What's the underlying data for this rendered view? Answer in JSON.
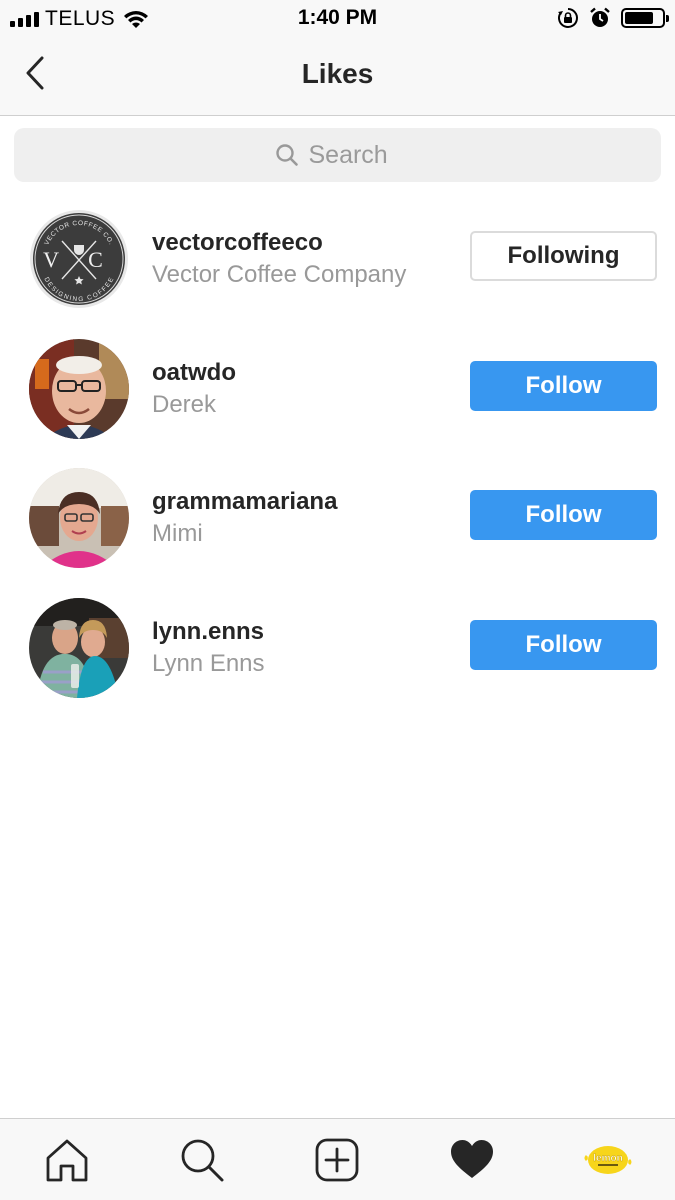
{
  "status_bar": {
    "carrier": "TELUS",
    "time": "1:40 PM"
  },
  "header": {
    "title": "Likes"
  },
  "search": {
    "placeholder": "Search"
  },
  "likes": [
    {
      "username": "vectorcoffeeco",
      "full_name": "Vector Coffee Company",
      "button": "Following",
      "button_state": "following",
      "avatar": "vector-coffee-logo"
    },
    {
      "username": "oatwdo",
      "full_name": "Derek",
      "button": "Follow",
      "button_state": "follow",
      "avatar": "photo"
    },
    {
      "username": "grammamariana",
      "full_name": "Mimi",
      "button": "Follow",
      "button_state": "follow",
      "avatar": "photo"
    },
    {
      "username": "lynn.enns",
      "full_name": "Lynn Enns",
      "button": "Follow",
      "button_state": "follow",
      "avatar": "photo"
    }
  ],
  "logo_text": {
    "vector_top": "VECTOR COFFEE CO.",
    "vector_bottom": "DESIGNING COFFEE",
    "vector_letters": "V C",
    "lemon": "lemon"
  },
  "tab_bar": {
    "icons": [
      "home-icon",
      "search-icon",
      "new-post-icon",
      "activity-heart-icon",
      "profile-avatar-icon"
    ]
  },
  "colors": {
    "follow_blue": "#3897f0",
    "text_primary": "#262626",
    "text_secondary": "#999999"
  }
}
